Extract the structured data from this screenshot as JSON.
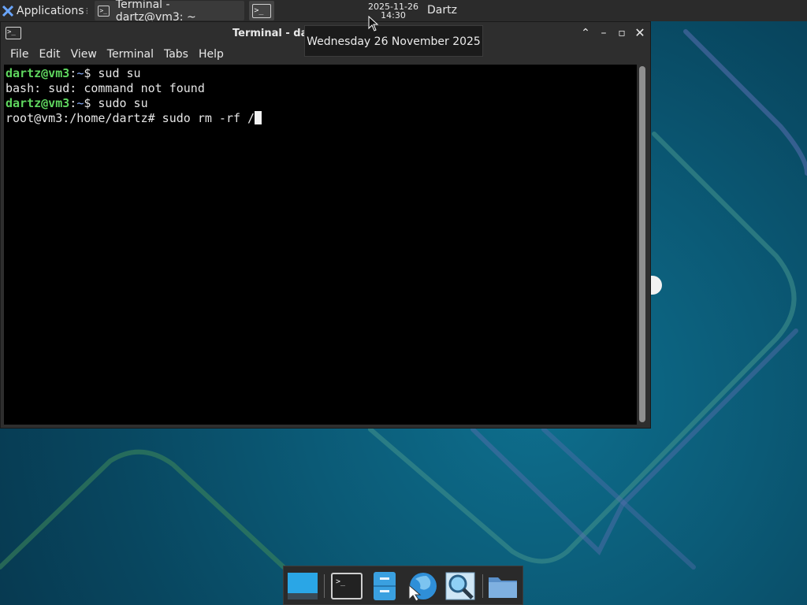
{
  "top_panel": {
    "applications_label": "Applications",
    "applications_separator": "⁝",
    "task_terminal_label": "Terminal - dartz@vm3: ~",
    "clock_date": "2025-11-26",
    "clock_time": "14:30",
    "user_name": "Dartz"
  },
  "tooltip": {
    "text": "Wednesday 26 November 2025"
  },
  "terminal_window": {
    "title": "Terminal - dartz@vm3: ~",
    "menu": [
      "File",
      "Edit",
      "View",
      "Terminal",
      "Tabs",
      "Help"
    ],
    "lines": [
      {
        "user": "dartz@vm3",
        "sep": ":",
        "path": "~",
        "symbol": "$ ",
        "cmd": "sud su"
      },
      {
        "output": "bash: sud: command not found"
      },
      {
        "user": "dartz@vm3",
        "sep": ":",
        "path": "~",
        "symbol": "$ ",
        "cmd": "sudo su"
      },
      {
        "output": "root@vm3:/home/dartz# sudo rm -rf /"
      }
    ]
  },
  "dock": {
    "items": [
      "desktop",
      "terminal",
      "file-manager",
      "web-browser",
      "app-finder",
      "folder"
    ]
  },
  "colors": {
    "panel_bg": "#2b2b2b",
    "terminal_bg": "#000000",
    "prompt_user": "#5fd75f",
    "prompt_path": "#8ab0ff"
  }
}
